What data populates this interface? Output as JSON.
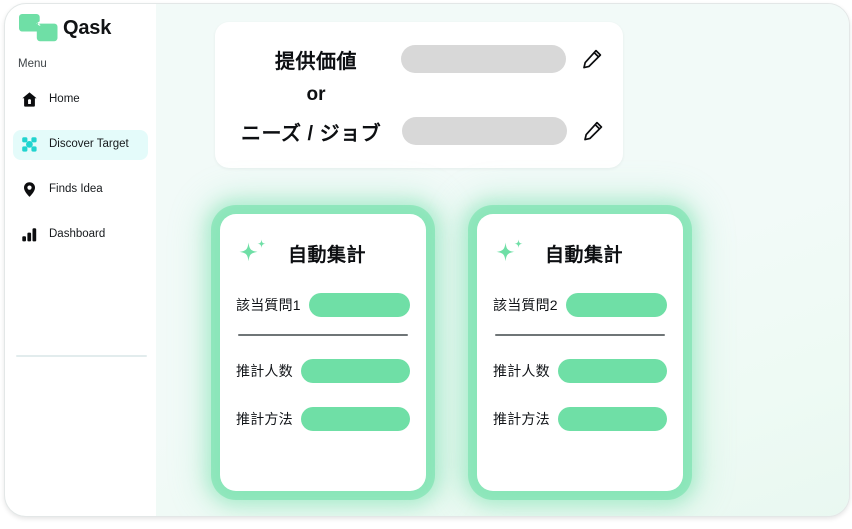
{
  "app": {
    "brand_name": "Qask",
    "logo_icon": "qask-logo-icon"
  },
  "sidebar": {
    "menu_label": "Menu",
    "items": [
      {
        "label": "Home",
        "icon": "home-icon",
        "active": false
      },
      {
        "label": "Discover Target",
        "icon": "target-icon",
        "active": true
      },
      {
        "label": "Finds Idea",
        "icon": "location-pin-icon",
        "active": false
      },
      {
        "label": "Dashboard",
        "icon": "bar-chart-icon",
        "active": false
      }
    ]
  },
  "value_card": {
    "label_one": "提供価値",
    "or_text": "or",
    "label_two": "ニーズ / ジョブ",
    "edit_icon": "pencil-icon",
    "value_one": "",
    "value_two": ""
  },
  "auto_cards": [
    {
      "icon": "sparkle-icon",
      "title": "自動集計",
      "question_label": "該当質問1",
      "question_value": "",
      "rows": [
        {
          "label": "推計人数",
          "value": ""
        },
        {
          "label": "推計方法",
          "value": ""
        }
      ]
    },
    {
      "icon": "sparkle-icon",
      "title": "自動集計",
      "question_label": "該当質問2",
      "question_value": "",
      "rows": [
        {
          "label": "推計人数",
          "value": ""
        },
        {
          "label": "推計方法",
          "value": ""
        }
      ]
    }
  ],
  "colors": {
    "brand_green": "#6fdfa6",
    "active_cyan": "#21d4cf",
    "active_bg": "#e4fbfa",
    "canvas_bg": "#f2faf8",
    "gray_pill": "#d8d8d8",
    "text_dark": "#0d0f12"
  }
}
